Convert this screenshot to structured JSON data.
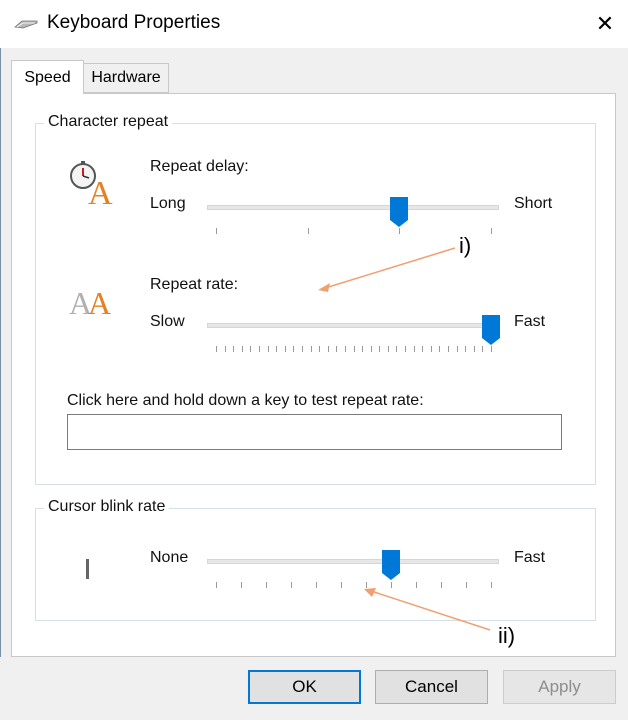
{
  "window": {
    "title": "Keyboard Properties",
    "close_glyph": "✕"
  },
  "tabs": [
    {
      "label": "Speed",
      "active": true
    },
    {
      "label": "Hardware",
      "active": false
    }
  ],
  "character_repeat": {
    "legend": "Character repeat",
    "repeat_delay": {
      "label": "Repeat delay:",
      "min_label": "Long",
      "max_label": "Short",
      "icon": "stopwatch-letter-a-icon",
      "tick_count": 4,
      "value_index": 2
    },
    "repeat_rate": {
      "label": "Repeat rate:",
      "min_label": "Slow",
      "max_label": "Fast",
      "icon": "double-letter-a-icon",
      "tick_count": 33,
      "value_index": 32
    },
    "test": {
      "label": "Click here and hold down a key to test repeat rate:",
      "value": ""
    }
  },
  "cursor_blink": {
    "legend": "Cursor blink rate",
    "min_label": "None",
    "max_label": "Fast",
    "icon": "text-cursor-icon",
    "tick_count": 12,
    "value_index": 7
  },
  "buttons": {
    "ok": "OK",
    "cancel": "Cancel",
    "apply": "Apply"
  },
  "annotations": [
    {
      "label": "i)",
      "color": "#f0a070"
    },
    {
      "label": "ii)",
      "color": "#f0a070"
    }
  ],
  "colors": {
    "accent": "#0078d7",
    "annotation_arrow": "#f0a070"
  }
}
